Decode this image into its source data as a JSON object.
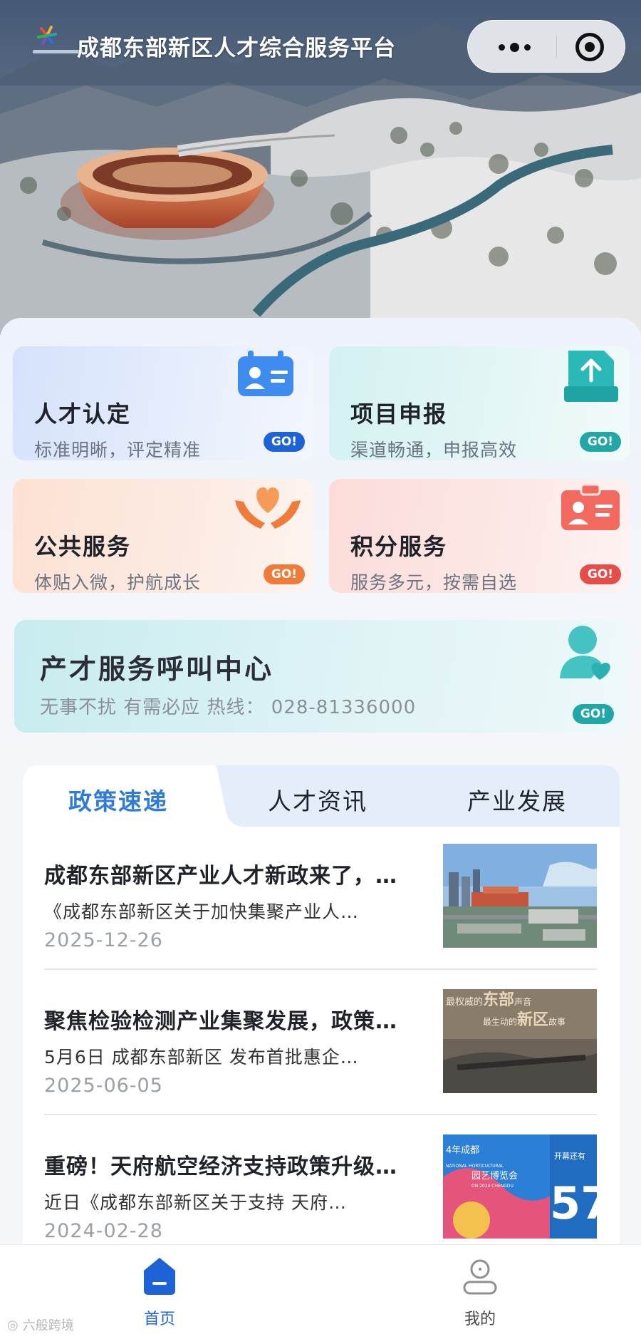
{
  "app": {
    "title": "成都东部新区人才综合服务平台"
  },
  "services": [
    {
      "title": "人才认定",
      "subtitle": "标准明晰，评定精准",
      "go": "GO!",
      "icon": "id-card-icon",
      "color": "#1e63d6"
    },
    {
      "title": "项目申报",
      "subtitle": "渠道畅通，申报高效",
      "go": "GO!",
      "icon": "upload-tray-icon",
      "color": "#21a7a6"
    },
    {
      "title": "公共服务",
      "subtitle": "体贴入微，护航成长",
      "go": "GO!",
      "icon": "heart-hands-icon",
      "color": "#f07a3a"
    },
    {
      "title": "积分服务",
      "subtitle": "服务多元，按需自选",
      "go": "GO!",
      "icon": "badge-card-icon",
      "color": "#e44d48"
    }
  ],
  "call_center": {
    "title": "产才服务呼叫中心",
    "subtitle": "无事不扰 有需必应 热线： 028-81336000",
    "go": "GO!",
    "icon": "service-person-icon"
  },
  "news_tabs": [
    {
      "label": "政策速递",
      "active": true
    },
    {
      "label": "人才资讯",
      "active": false
    },
    {
      "label": "产业发展",
      "active": false
    }
  ],
  "news": [
    {
      "title": "成都东部新区产业人才新政来了，…",
      "summary": "《成都东部新区关于加快集聚产业人…",
      "date": "2025-12-26"
    },
    {
      "title": "聚焦检验检测产业集聚发展，政策…",
      "summary": "5月6日 成都东部新区 发布首批惠企…",
      "date": "2025-06-05"
    },
    {
      "title": "重磅！天府航空经济支持政策升级…",
      "summary": "近日《成都东部新区关于支持 天府…",
      "date": "2024-02-28"
    }
  ],
  "thumb_text": {
    "t2_line1a": "最权威的",
    "t2_line1b": "东部",
    "t2_line1c": "声音",
    "t2_line2a": "最生动的",
    "t2_line2b": "新区",
    "t2_line2c": "故事",
    "t3_line1": "4年成都",
    "t3_line2": "开幕还有",
    "t3_line3": "NATIONAL HORTICULTURAL",
    "t3_line4": "园艺博览会",
    "t3_line5": "ON 2024 CHENGDU",
    "t3_num": "57"
  },
  "bottom_nav": [
    {
      "label": "首页",
      "icon": "home-icon",
      "active": true
    },
    {
      "label": "我的",
      "icon": "user-icon",
      "active": false
    }
  ],
  "watermark": "六般跨境"
}
